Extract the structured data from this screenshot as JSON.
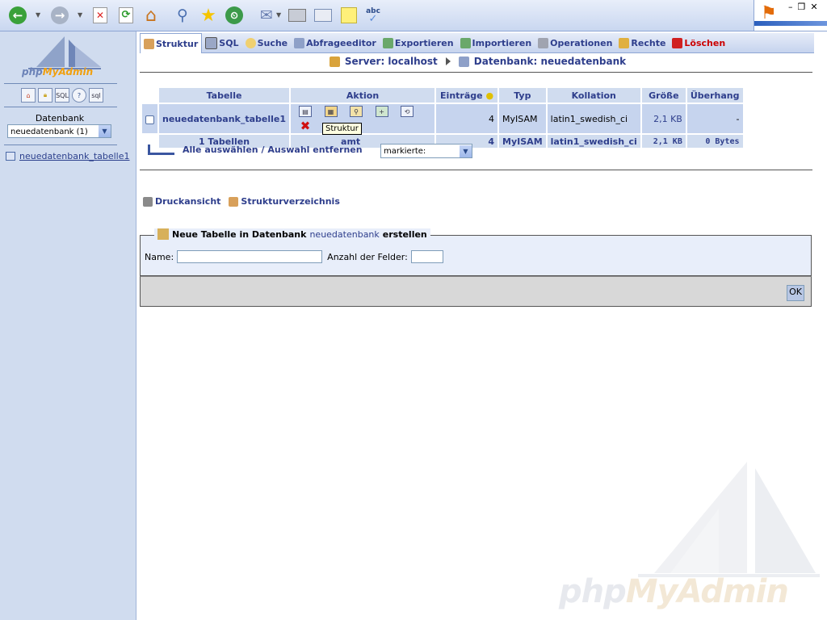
{
  "browser": {
    "toolbar_icons": [
      "back-icon",
      "forward-icon",
      "stop-icon",
      "refresh-icon",
      "home-icon",
      "search-icon",
      "favorites-icon",
      "history-icon",
      "mail-icon",
      "print-icon",
      "edit-icon",
      "discuss-icon",
      "spellcheck-icon"
    ]
  },
  "sidebar": {
    "logo_text_1": "php",
    "logo_text_2": "MyAdmin",
    "icons": [
      "home-icon",
      "lock-icon",
      "sql-icon",
      "help-icon",
      "sql-query-icon"
    ],
    "db_label": "Datenbank",
    "db_selected": "neuedatenbank (1)",
    "table_link": "neuedatenbank_tabelle1"
  },
  "tabs": [
    {
      "label": "Struktur",
      "icon": "structure-icon",
      "active": true
    },
    {
      "label": "SQL",
      "icon": "sql-icon"
    },
    {
      "label": "Suche",
      "icon": "search-icon"
    },
    {
      "label": "Abfrageeditor",
      "icon": "query-icon"
    },
    {
      "label": "Exportieren",
      "icon": "export-icon"
    },
    {
      "label": "Importieren",
      "icon": "import-icon"
    },
    {
      "label": "Operationen",
      "icon": "operations-icon"
    },
    {
      "label": "Rechte",
      "icon": "privileges-icon"
    },
    {
      "label": "Löschen",
      "icon": "drop-icon"
    }
  ],
  "breadcrumb": {
    "server": "Server: localhost",
    "database": "Datenbank: neuedatenbank"
  },
  "table": {
    "headers": [
      "Tabelle",
      "Aktion",
      "Einträge",
      "Typ",
      "Kollation",
      "Größe",
      "Überhang"
    ],
    "row": {
      "name": "neuedatenbank_tabelle1",
      "actions": [
        "browse-icon",
        "structure-icon",
        "search-icon",
        "insert-icon",
        "empty-icon",
        "drop-icon"
      ],
      "entries": "4",
      "type": "MyISAM",
      "collation": "latin1_swedish_ci",
      "size": "2,1 KB",
      "overhead": "-"
    },
    "summary": {
      "count": "1 Tabellen",
      "total": "amt",
      "entries": "4",
      "type": "MyISAM",
      "collation": "latin1_swedish_ci",
      "size": "2,1 KB",
      "overhead": "0 Bytes"
    },
    "tooltip": "Struktur"
  },
  "bulk": {
    "select_all": "Alle auswählen",
    "separator": "/",
    "deselect_all": "Auswahl entfernen",
    "with_selected": "markierte:"
  },
  "links": {
    "print_view": "Druckansicht",
    "data_dictionary": "Strukturverzeichnis"
  },
  "create_table": {
    "legend_prefix": "Neue Tabelle in Datenbank",
    "db_name": "neuedatenbank",
    "legend_suffix": "erstellen",
    "name_label": "Name:",
    "name_value": "",
    "fields_label": "Anzahl der Felder:",
    "fields_value": "",
    "ok_label": "OK"
  },
  "watermark": {
    "text_1": "php",
    "text_2": "MyAdmin"
  }
}
